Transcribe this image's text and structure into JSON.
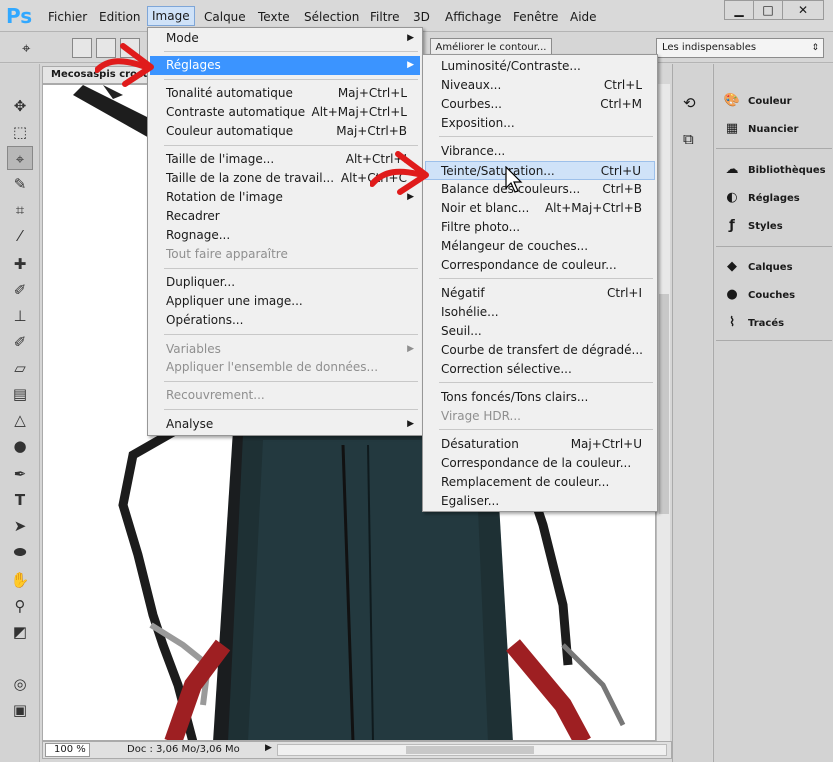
{
  "app": {
    "logo": "Ps"
  },
  "menubar": {
    "items": [
      "Fichier",
      "Edition",
      "Image",
      "Calque",
      "Texte",
      "Sélection",
      "Filtre",
      "3D",
      "Affichage",
      "Fenêtre",
      "Aide"
    ],
    "active": "Image"
  },
  "options": {
    "refine_edge": "Améliorer le contour...",
    "workspace": "Les indispensables"
  },
  "document": {
    "tab_title": "Mecosaspis crocu",
    "zoom": "100 %",
    "doc_info": "Doc : 3,06 Mo/3,06 Mo"
  },
  "image_menu": {
    "items": [
      {
        "label": "Mode",
        "submenu": true
      },
      {
        "label": "Réglages",
        "submenu": true,
        "highlighted": true
      },
      {
        "label": "Tonalité automatique",
        "shortcut": "Maj+Ctrl+L"
      },
      {
        "label": "Contraste automatique",
        "shortcut": "Alt+Maj+Ctrl+L"
      },
      {
        "label": "Couleur automatique",
        "shortcut": "Maj+Ctrl+B"
      },
      {
        "label": "Taille de l'image...",
        "shortcut": "Alt+Ctrl+I"
      },
      {
        "label": "Taille de la zone de travail...",
        "shortcut": "Alt+Ctrl+C"
      },
      {
        "label": "Rotation de l'image",
        "submenu": true
      },
      {
        "label": "Recadrer"
      },
      {
        "label": "Rognage..."
      },
      {
        "label": "Tout faire apparaître",
        "disabled": true
      },
      {
        "label": "Dupliquer..."
      },
      {
        "label": "Appliquer une image..."
      },
      {
        "label": "Opérations..."
      },
      {
        "label": "Variables",
        "submenu": true,
        "disabled": true
      },
      {
        "label": "Appliquer l'ensemble de données...",
        "disabled": true
      },
      {
        "label": "Recouvrement...",
        "disabled": true
      },
      {
        "label": "Analyse",
        "submenu": true
      }
    ]
  },
  "adjust_menu": {
    "items": [
      {
        "label": "Luminosité/Contraste..."
      },
      {
        "label": "Niveaux...",
        "shortcut": "Ctrl+L"
      },
      {
        "label": "Courbes...",
        "shortcut": "Ctrl+M"
      },
      {
        "label": "Exposition..."
      },
      {
        "label": "Vibrance..."
      },
      {
        "label": "Teinte/Saturation...",
        "shortcut": "Ctrl+U",
        "highlighted": true
      },
      {
        "label": "Balance des couleurs...",
        "shortcut": "Ctrl+B"
      },
      {
        "label": "Noir et blanc...",
        "shortcut": "Alt+Maj+Ctrl+B"
      },
      {
        "label": "Filtre photo..."
      },
      {
        "label": "Mélangeur de couches..."
      },
      {
        "label": "Correspondance de couleur..."
      },
      {
        "label": "Négatif",
        "shortcut": "Ctrl+I"
      },
      {
        "label": "Isohélie..."
      },
      {
        "label": "Seuil..."
      },
      {
        "label": "Courbe de transfert de dégradé..."
      },
      {
        "label": "Correction sélective..."
      },
      {
        "label": "Tons foncés/Tons clairs..."
      },
      {
        "label": "Virage HDR...",
        "disabled": true
      },
      {
        "label": "Désaturation",
        "shortcut": "Maj+Ctrl+U"
      },
      {
        "label": "Correspondance de la couleur..."
      },
      {
        "label": "Remplacement de couleur..."
      },
      {
        "label": "Egaliser..."
      }
    ]
  },
  "right_panel": {
    "groups": [
      [
        {
          "label": "Couleur",
          "icon": "palette-icon"
        },
        {
          "label": "Nuancier",
          "icon": "swatches-icon"
        }
      ],
      [
        {
          "label": "Bibliothèques",
          "icon": "libraries-icon"
        },
        {
          "label": "Réglages",
          "icon": "adjustments-icon"
        },
        {
          "label": "Styles",
          "icon": "styles-icon"
        }
      ],
      [
        {
          "label": "Calques",
          "icon": "layers-icon"
        },
        {
          "label": "Couches",
          "icon": "channels-icon"
        },
        {
          "label": "Tracés",
          "icon": "paths-icon"
        }
      ]
    ]
  },
  "colors": {
    "highlight": "#3b94ff",
    "annotation_arrow": "#e01b1b"
  }
}
